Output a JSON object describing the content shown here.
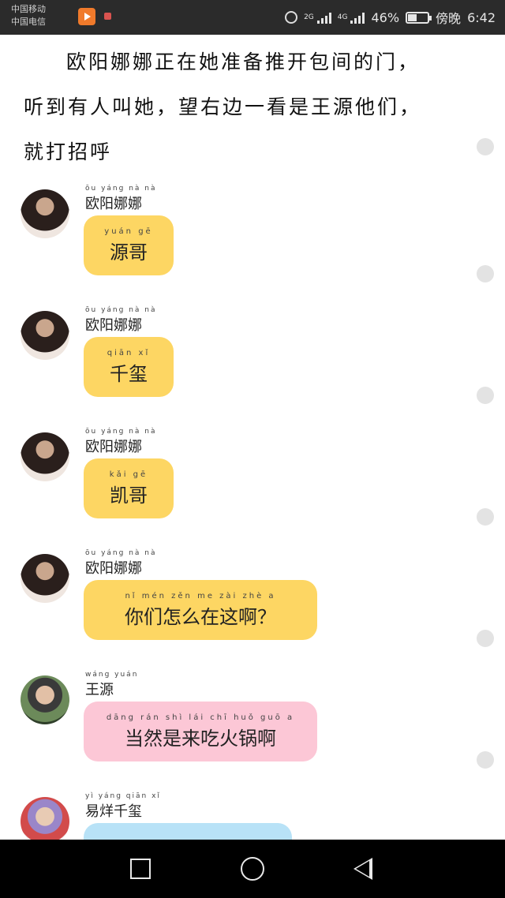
{
  "status_bar": {
    "carrier1": "中国移动",
    "carrier2": "中国电信",
    "network_label": "2G",
    "network_label2": "4G",
    "battery": "46%",
    "battery_level": 0.46,
    "time_prefix": "傍晚",
    "time": "6:42"
  },
  "narration": {
    "line1": "欧阳娜娜正在她准备推开包间的门，",
    "line2": "听到有人叫她，望右边一看是王源他们，",
    "line3": "就打招呼"
  },
  "messages": [
    {
      "sender": "欧阳娜娜",
      "sender_pinyin": "ōu yáng nà nà",
      "text": "源哥",
      "pinyin": "yuán gē",
      "color": "yellow"
    },
    {
      "sender": "欧阳娜娜",
      "sender_pinyin": "ōu yáng nà nà",
      "text": "千玺",
      "pinyin": "qiān xǐ",
      "color": "yellow"
    },
    {
      "sender": "欧阳娜娜",
      "sender_pinyin": "ōu yáng nà nà",
      "text": "凯哥",
      "pinyin": "kǎi gē",
      "color": "yellow"
    },
    {
      "sender": "欧阳娜娜",
      "sender_pinyin": "ōu yáng nà nà",
      "text": "你们怎么在这啊？",
      "pinyin": "nǐ mén zěn me zài zhè a",
      "color": "yellow"
    },
    {
      "sender": "王源",
      "sender_pinyin": "wáng yuán",
      "text": "当然是来吃火锅啊",
      "pinyin": "dāng rán shì lái chī huǒ guō a",
      "color": "pink"
    },
    {
      "sender": "易烊千玺",
      "sender_pinyin": "yì yáng qiān xǐ",
      "text": "",
      "pinyin": "",
      "color": "blue"
    }
  ],
  "colors": {
    "yellow_bubble": "#fdd663",
    "pink_bubble": "#fcc7d6",
    "blue_bubble": "#b8e2f7",
    "status_bar": "#2b2b2b",
    "nav_bar": "#000000"
  },
  "icons": [
    "alarm-icon",
    "signal-icon",
    "battery-icon",
    "video-app-icon",
    "notification-icon",
    "recent-apps-icon",
    "home-icon",
    "back-icon"
  ]
}
